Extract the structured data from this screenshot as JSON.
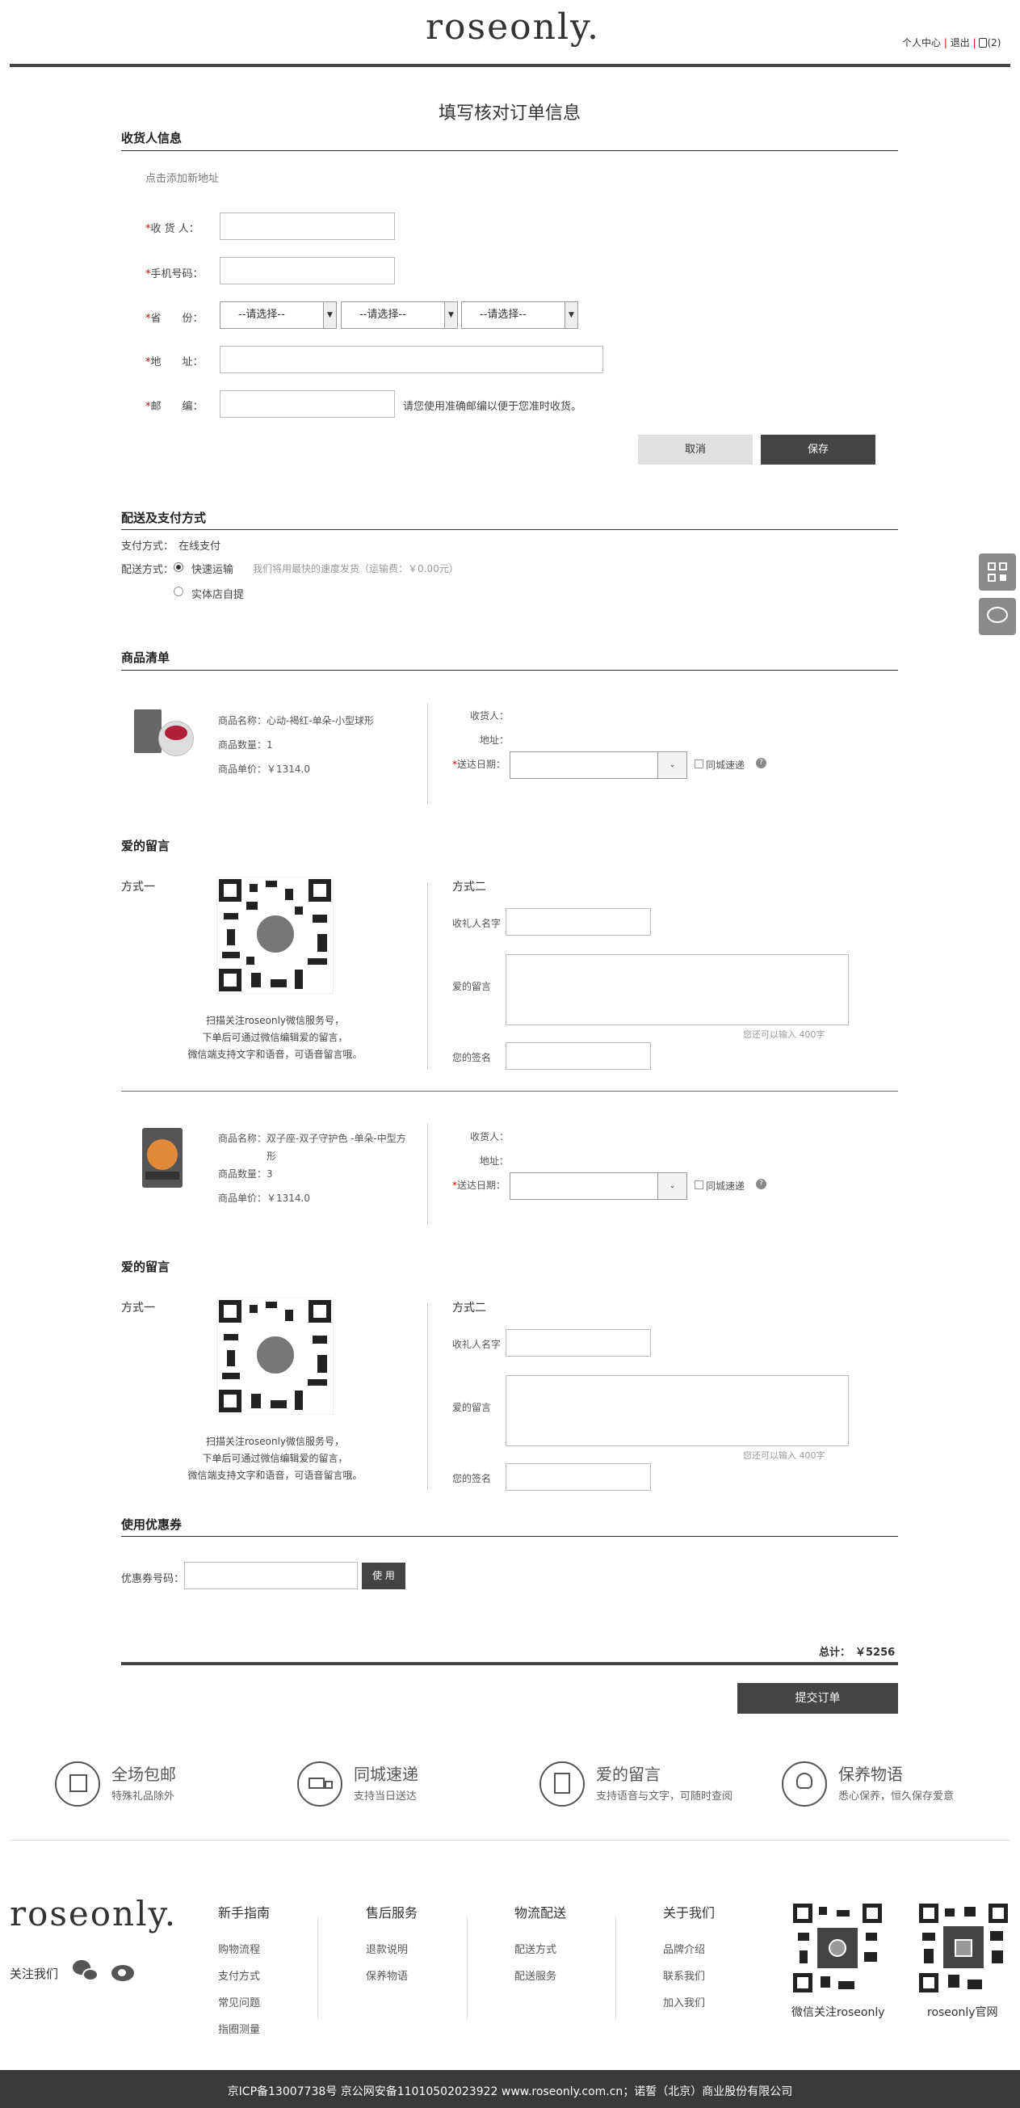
{
  "header": {
    "logo": "roseonly.",
    "nav": {
      "personal": "个人中心",
      "logout": "退出",
      "cart_count": "(2)"
    }
  },
  "page_title": "填写核对订单信息",
  "receiver": {
    "section_title": "收货人信息",
    "add_address": "点击添加新地址",
    "name_label": "收 货 人：",
    "phone_label": "手机号码：",
    "province_label": "省　　份：",
    "address_label": "地　　址：",
    "zip_label": "邮　　编：",
    "select_placeholder": "--请选择--",
    "zip_hint": "请您使用准确邮编以便于您准时收货。",
    "cancel": "取消",
    "save": "保存"
  },
  "delivery": {
    "section_title": "配送及支付方式",
    "pay_label": "支付方式：",
    "pay_value": "在线支付",
    "ship_label": "配送方式：",
    "option_express": "快速运输",
    "express_note": "我们将用最快的速度发货（运输费：￥0.00元）",
    "option_pickup": "实体店自提"
  },
  "goods": {
    "section_title": "商品清单",
    "receiver_label": "收货人：",
    "address_label": "地址：",
    "date_label": "送达日期：",
    "same_city": "同城速递",
    "help": "?",
    "items": [
      {
        "name": "商品名称：心动-褐红-单朵-小型球形",
        "name2": "",
        "qty": "商品数量：1",
        "price": "商品单价：￥1314.0"
      },
      {
        "name": "商品名称：双子座-双子守护色 -单朵-中型方",
        "name2": "形",
        "qty": "商品数量：3",
        "price": "商品单价：￥1314.0"
      }
    ]
  },
  "message": {
    "section_title": "爱的留言",
    "method1": "方式一",
    "method2": "方式二",
    "scan_line1": "扫描关注roseonly微信服务号，",
    "scan_line2": "下单后可通过微信编辑爱的留言，",
    "scan_line3": "微信端支持文字和语音，可语音留言哦。",
    "recipient_label": "收礼人名字",
    "love_label": "爱的留言",
    "remain": "您还可以输入 400字",
    "sign_label": "您的签名"
  },
  "coupon": {
    "section_title": "使用优惠券",
    "label": "优惠券号码：",
    "use": "使 用"
  },
  "summary": {
    "total_label": "总计：",
    "total_value": "￥5256",
    "submit": "提交订单"
  },
  "features": [
    {
      "icon": "box-icon",
      "title": "全场包邮",
      "sub": "特殊礼品除外"
    },
    {
      "icon": "truck-icon",
      "title": "同城速递",
      "sub": "支持当日送达"
    },
    {
      "icon": "note-icon",
      "title": "爱的留言",
      "sub": "支持语音与文字，可随时查阅"
    },
    {
      "icon": "flower-icon",
      "title": "保养物语",
      "sub": "悉心保养，恒久保存爱意"
    }
  ],
  "footer": {
    "logo": "roseonly.",
    "follow": "关注我们",
    "columns": [
      {
        "title": "新手指南",
        "links": [
          "购物流程",
          "支付方式",
          "常见问题",
          "指圈测量"
        ]
      },
      {
        "title": "售后服务",
        "links": [
          "退款说明",
          "保养物语"
        ]
      },
      {
        "title": "物流配送",
        "links": [
          "配送方式",
          "配送服务"
        ]
      },
      {
        "title": "关于我们",
        "links": [
          "品牌介绍",
          "联系我们",
          "加入我们"
        ]
      }
    ],
    "qr1_caption": "微信关注roseonly",
    "qr2_caption": "roseonly官网",
    "icp": "京ICP备13007738号 京公网安备11010502023922 www.roseonly.com.cn；诺誓（北京）商业股份有限公司"
  }
}
